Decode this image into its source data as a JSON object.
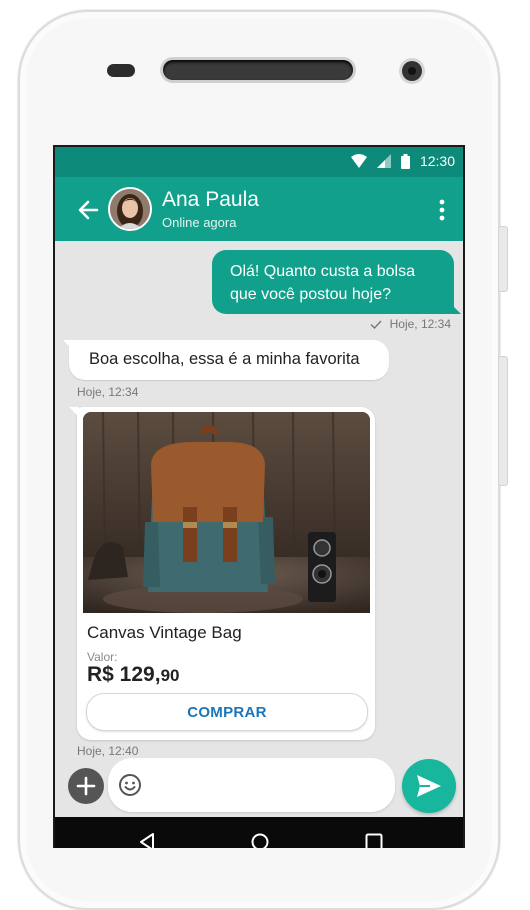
{
  "status_bar": {
    "time": "12:30"
  },
  "header": {
    "contact_name": "Ana Paula",
    "contact_status": "Online agora"
  },
  "messages": {
    "outgoing": {
      "text_line1": "Olá! Quanto custa a bolsa",
      "text_line2": "que você postou hoje?",
      "time": "Hoje, 12:34"
    },
    "incoming": {
      "text": "Boa escolha, essa é a minha favorita",
      "time": "Hoje, 12:34"
    },
    "product_card": {
      "name": "Canvas Vintage Bag",
      "price_label": "Valor:",
      "price_main": "R$ 129,",
      "price_cents": "90",
      "buy_label": "COMPRAR",
      "time": "Hoje,  12:40"
    }
  },
  "composer": {
    "placeholder": ""
  },
  "colors": {
    "status_bar": "#0d8a79",
    "app_bar": "#11a08b",
    "outgoing_bubble": "#11a08b",
    "send_button": "#19b69e",
    "buy_text": "#1976b8"
  }
}
